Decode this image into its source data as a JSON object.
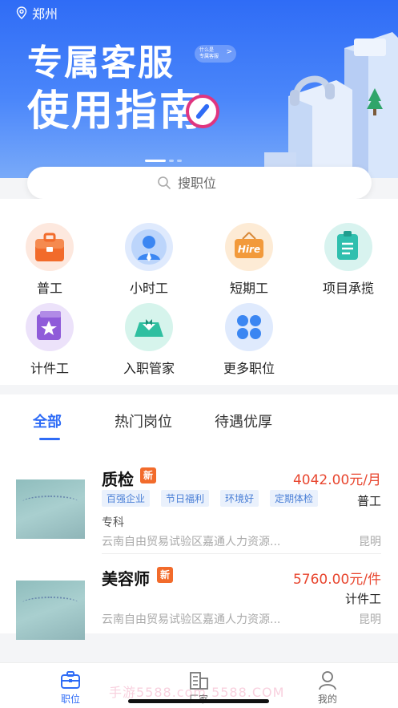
{
  "location": {
    "city": "郑州"
  },
  "banner": {
    "title_line1": "专属客服",
    "title_line2": "使用指南",
    "pill_line1": "什么是",
    "pill_line2": "专属客服",
    "pill_chevron": ">"
  },
  "search": {
    "placeholder": "搜职位"
  },
  "categories": [
    {
      "label": "普工",
      "icon": "toolbox-icon",
      "color": "#f26b2b"
    },
    {
      "label": "小时工",
      "icon": "worker-avatar-icon",
      "color": "#3b86f2"
    },
    {
      "label": "短期工",
      "icon": "hire-sign-icon",
      "color": "#f29a3b",
      "icon_text": "Hire"
    },
    {
      "label": "项目承揽",
      "icon": "clipboard-icon",
      "color": "#2fbfae"
    },
    {
      "label": "计件工",
      "icon": "star-box-icon",
      "color": "#8f5bd9"
    },
    {
      "label": "入职管家",
      "icon": "butler-icon",
      "color": "#2fbfa0"
    },
    {
      "label": "更多职位",
      "icon": "grid-more-icon",
      "color": "#3b86f2"
    }
  ],
  "tabs": [
    {
      "label": "全部",
      "active": true
    },
    {
      "label": "热门岗位",
      "active": false
    },
    {
      "label": "待遇优厚",
      "active": false
    }
  ],
  "jobs": [
    {
      "title": "质检",
      "badge": "新",
      "salary": "4042.00元/月",
      "kind": "普工",
      "tags": [
        "百强企业",
        "节日福利",
        "环境好",
        "定期体检"
      ],
      "education": "专科",
      "company": "云南自由贸易试验区嘉通人力资源...",
      "city": "昆明"
    },
    {
      "title": "美容师",
      "badge": "新",
      "salary": "5760.00元/件",
      "kind": "计件工",
      "tags": [],
      "education": "",
      "company": "云南自由贸易试验区嘉通人力资源...",
      "city": "昆明"
    }
  ],
  "bottom_nav": [
    {
      "label": "职位",
      "icon": "briefcase-icon",
      "active": true
    },
    {
      "label": "厂家",
      "icon": "factory-icon",
      "active": false
    },
    {
      "label": "我的",
      "icon": "person-icon",
      "active": false
    }
  ],
  "watermark": "手游5588.com 5588.COM",
  "colors": {
    "accent": "#2f6cf6",
    "salary": "#e8462f",
    "badge": "#f26b2b"
  }
}
